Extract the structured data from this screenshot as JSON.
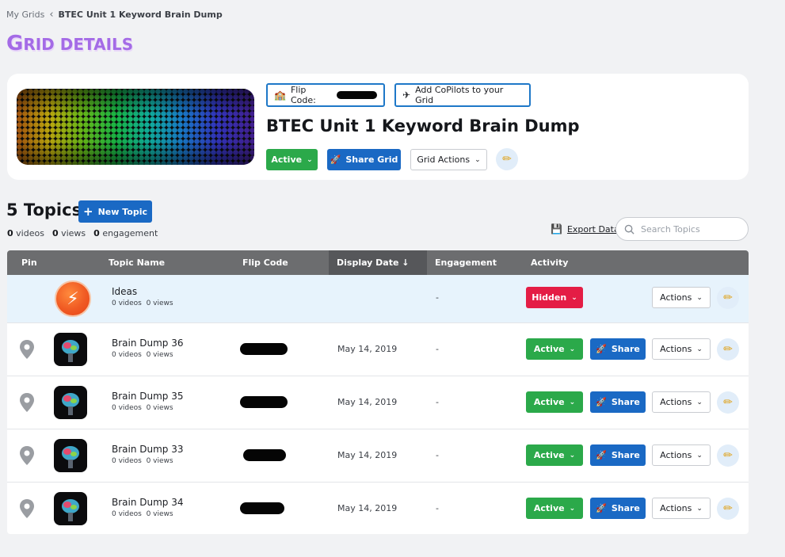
{
  "breadcrumb": {
    "root": "My Grids",
    "current": "BTEC Unit 1 Keyword Brain Dump"
  },
  "page_title": {
    "first": "G",
    "rest": "RID DETAILS"
  },
  "grid": {
    "flip_code_label": "Flip Code:",
    "copilots_label": "Add CoPilots to your Grid",
    "title": "BTEC Unit 1 Keyword Brain Dump",
    "status_label": "Active",
    "share_label": "Share Grid",
    "actions_label": "Grid Actions"
  },
  "topics": {
    "count_label": "5 Topics",
    "new_topic_label": "New Topic",
    "stats": {
      "videos": "0",
      "videos_label": "videos",
      "views": "0",
      "views_label": "views",
      "engagement": "0",
      "engagement_label": "engagement"
    },
    "export_label": "Export Data",
    "search_placeholder": "Search Topics"
  },
  "table": {
    "columns": [
      "Pin",
      "Topic Name",
      "Flip Code",
      "Display Date ↓",
      "Engagement",
      "Activity"
    ],
    "rows": [
      {
        "name": "Ideas",
        "videos": "0 videos",
        "views": "0 views",
        "date": "",
        "engagement": "-",
        "status": "Hidden",
        "share": "",
        "actions": "Actions"
      },
      {
        "name": "Brain Dump 36",
        "videos": "0 videos",
        "views": "0 views",
        "date": "May 14, 2019",
        "engagement": "-",
        "status": "Active",
        "share": "Share",
        "actions": "Actions"
      },
      {
        "name": "Brain Dump 35",
        "videos": "0 videos",
        "views": "0 views",
        "date": "May 14, 2019",
        "engagement": "-",
        "status": "Active",
        "share": "Share",
        "actions": "Actions"
      },
      {
        "name": "Brain Dump 33",
        "videos": "0 videos",
        "views": "0 views",
        "date": "May 14, 2019",
        "engagement": "-",
        "status": "Active",
        "share": "Share",
        "actions": "Actions"
      },
      {
        "name": "Brain Dump 34",
        "videos": "0 videos",
        "views": "0 views",
        "date": "May 14, 2019",
        "engagement": "-",
        "status": "Active",
        "share": "Share",
        "actions": "Actions"
      }
    ]
  },
  "colors": {
    "accent_purple": "#a46be6",
    "active_green": "#2ba94a",
    "share_blue": "#1a69c4",
    "hidden_red": "#e41d45",
    "header_gray": "#6c6d6f"
  },
  "icons": {
    "breadcrumb_sep": "chevron-left-icon",
    "flip_code": "school-icon",
    "copilots": "airplane-icon",
    "share": "rocket-icon",
    "edit": "pencil-icon",
    "export": "save-icon",
    "search": "search-icon",
    "pin": "map-pin-icon",
    "ideas": "lightning-icon"
  }
}
